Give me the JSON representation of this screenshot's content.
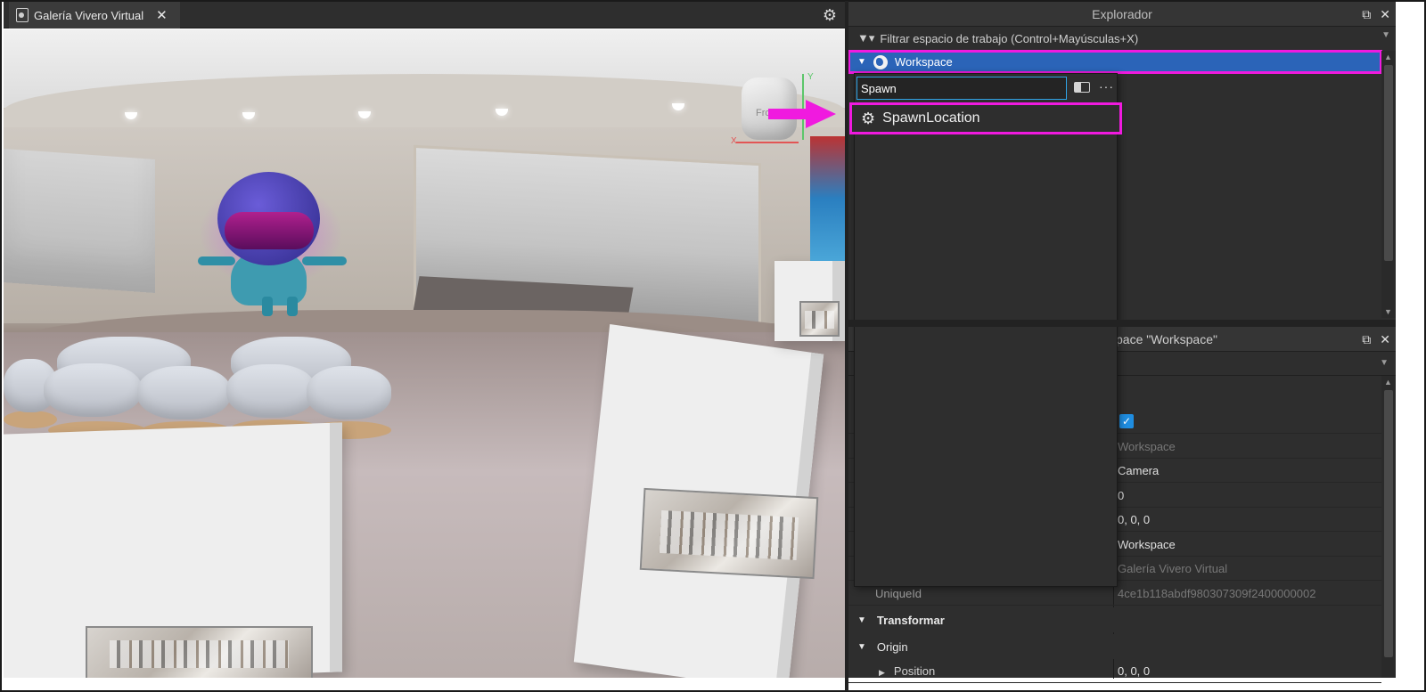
{
  "document_tab": {
    "label": "Galería Vivero Virtual",
    "close_glyph": "✕",
    "icon": "place-file-icon"
  },
  "studio_settings_icon": "gear-icon",
  "viewport": {
    "nav_cube_label": "Front",
    "axis_y": "Y",
    "axis_x": "X"
  },
  "explorer": {
    "title": "Explorador",
    "float_glyph": "⧉",
    "close_glyph": "✕",
    "filter_label": "Filtrar espacio de trabajo (Control+Mayúsculas+X)",
    "workspace_label": "Workspace"
  },
  "search": {
    "value": "Spawn",
    "result_label": "SpawnLocation"
  },
  "properties": {
    "title": "pace \"Workspace\"",
    "float_glyph": "⧉",
    "close_glyph": "✕",
    "rows": [
      {
        "value": "",
        "checked": true
      },
      {
        "value": "Workspace",
        "dim": true
      },
      {
        "value": "Camera"
      },
      {
        "value": "0"
      },
      {
        "value": "0, 0, 0"
      },
      {
        "value": "Workspace"
      },
      {
        "value": "Galería Vivero Virtual",
        "dim": true
      },
      {
        "name": "UniqueId",
        "value": "4ce1b118abdf980307309f2400000002",
        "dim": true
      }
    ],
    "section_transform": "Transformar",
    "origin_label": "Origin",
    "position_label": "Position",
    "position_value": "0, 0, 0"
  },
  "colors": {
    "highlight": "#f01adf",
    "selection": "#2b64b8",
    "accent_input_border": "#2fa3e6",
    "panel_bg": "#2e2e2e"
  }
}
